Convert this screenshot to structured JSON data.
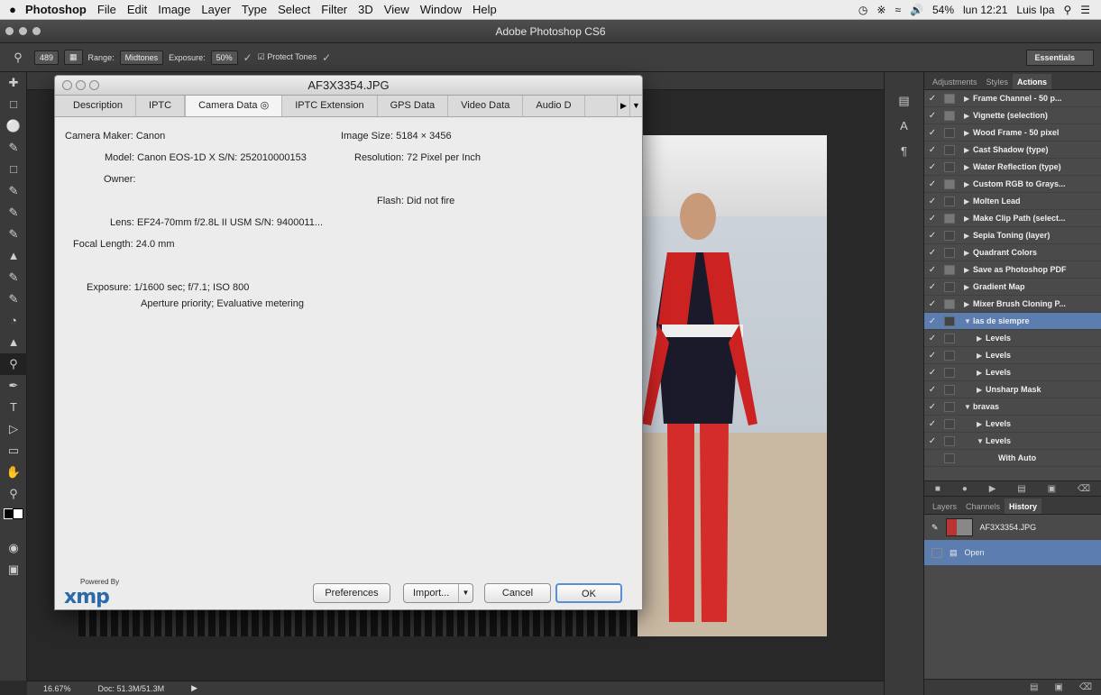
{
  "menubar": {
    "app": "Photoshop",
    "items": [
      "File",
      "Edit",
      "Image",
      "Layer",
      "Type",
      "Select",
      "Filter",
      "3D",
      "View",
      "Window",
      "Help"
    ],
    "battery": "54%",
    "clock": "lun 12:21",
    "user": "Luis Ipa"
  },
  "window": {
    "title": "Adobe Photoshop CS6"
  },
  "options": {
    "brush_size": "489",
    "range_label": "Range:",
    "range_value": "Midtones",
    "exposure_label": "Exposure:",
    "exposure_value": "50%",
    "protect_tones": "Protect Tones",
    "workspace": "Essentials"
  },
  "status": {
    "zoom": "16.67%",
    "doc": "Doc: 51.3M/51.3M"
  },
  "actions_panel": {
    "tabs": [
      "Adjustments",
      "Styles",
      "Actions"
    ],
    "rows": [
      {
        "label": "Frame Channel - 50 p...",
        "indent": 0,
        "tri": "▶",
        "box": true
      },
      {
        "label": "Vignette (selection)",
        "indent": 0,
        "tri": "▶",
        "box": true
      },
      {
        "label": "Wood Frame - 50 pixel",
        "indent": 0,
        "tri": "▶",
        "box": false
      },
      {
        "label": "Cast Shadow (type)",
        "indent": 0,
        "tri": "▶",
        "box": false
      },
      {
        "label": "Water Reflection (type)",
        "indent": 0,
        "tri": "▶",
        "box": false
      },
      {
        "label": "Custom RGB to Grays...",
        "indent": 0,
        "tri": "▶",
        "box": true
      },
      {
        "label": "Molten Lead",
        "indent": 0,
        "tri": "▶",
        "box": false
      },
      {
        "label": "Make Clip Path (select...",
        "indent": 0,
        "tri": "▶",
        "box": true
      },
      {
        "label": "Sepia Toning (layer)",
        "indent": 0,
        "tri": "▶",
        "box": false
      },
      {
        "label": "Quadrant Colors",
        "indent": 0,
        "tri": "▶",
        "box": false
      },
      {
        "label": "Save as Photoshop PDF",
        "indent": 0,
        "tri": "▶",
        "box": true
      },
      {
        "label": "Gradient Map",
        "indent": 0,
        "tri": "▶",
        "box": false
      },
      {
        "label": "Mixer Brush Cloning P...",
        "indent": 0,
        "tri": "▶",
        "box": true
      },
      {
        "label": "las de siempre",
        "indent": 0,
        "tri": "▼",
        "box": false,
        "selected": true
      },
      {
        "label": "Levels",
        "indent": 1,
        "tri": "▶",
        "box": false
      },
      {
        "label": "Levels",
        "indent": 1,
        "tri": "▶",
        "box": false
      },
      {
        "label": "Levels",
        "indent": 1,
        "tri": "▶",
        "box": false
      },
      {
        "label": "Unsharp Mask",
        "indent": 1,
        "tri": "▶",
        "box": false
      },
      {
        "label": "bravas",
        "indent": 0,
        "tri": "▼",
        "box": false
      },
      {
        "label": "Levels",
        "indent": 1,
        "tri": "▶",
        "box": false
      },
      {
        "label": "Levels",
        "indent": 1,
        "tri": "▼",
        "box": false
      },
      {
        "label": "With Auto",
        "indent": 2,
        "tri": "",
        "box": false,
        "nocheck": true
      }
    ]
  },
  "history_panel": {
    "tabs": [
      "Layers",
      "Channels",
      "History"
    ],
    "snapshot": "AF3X3354.JPG",
    "open_label": "Open"
  },
  "dialog": {
    "title": "AF3X3354.JPG",
    "tabs": [
      "Description",
      "IPTC",
      "Camera Data",
      "IPTC Extension",
      "GPS Data",
      "Video Data",
      "Audio D"
    ],
    "fields": {
      "camera_maker_label": "Camera Maker:",
      "camera_maker": "Canon",
      "model_label": "Model:",
      "model": "Canon EOS-1D X  S/N: 252010000153",
      "owner_label": "Owner:",
      "lens_label": "Lens:",
      "lens": "EF24-70mm f/2.8L II USM  S/N: 9400011...",
      "focal_label": "Focal Length:",
      "focal": "24.0 mm",
      "exposure_label": "Exposure:",
      "exposure": "1/1600 sec;  f/7.1;  ISO 800",
      "exposure2": "Aperture priority;  Evaluative metering",
      "image_size_label": "Image Size:",
      "image_size": "5184 × 3456",
      "resolution_label": "Resolution:",
      "resolution": "72 Pixel per Inch",
      "flash_label": "Flash:",
      "flash": "Did not fire"
    },
    "powered_by": "Powered By",
    "xmp_logo": "xmp",
    "buttons": {
      "preferences": "Preferences",
      "import": "Import...",
      "cancel": "Cancel",
      "ok": "OK"
    }
  }
}
